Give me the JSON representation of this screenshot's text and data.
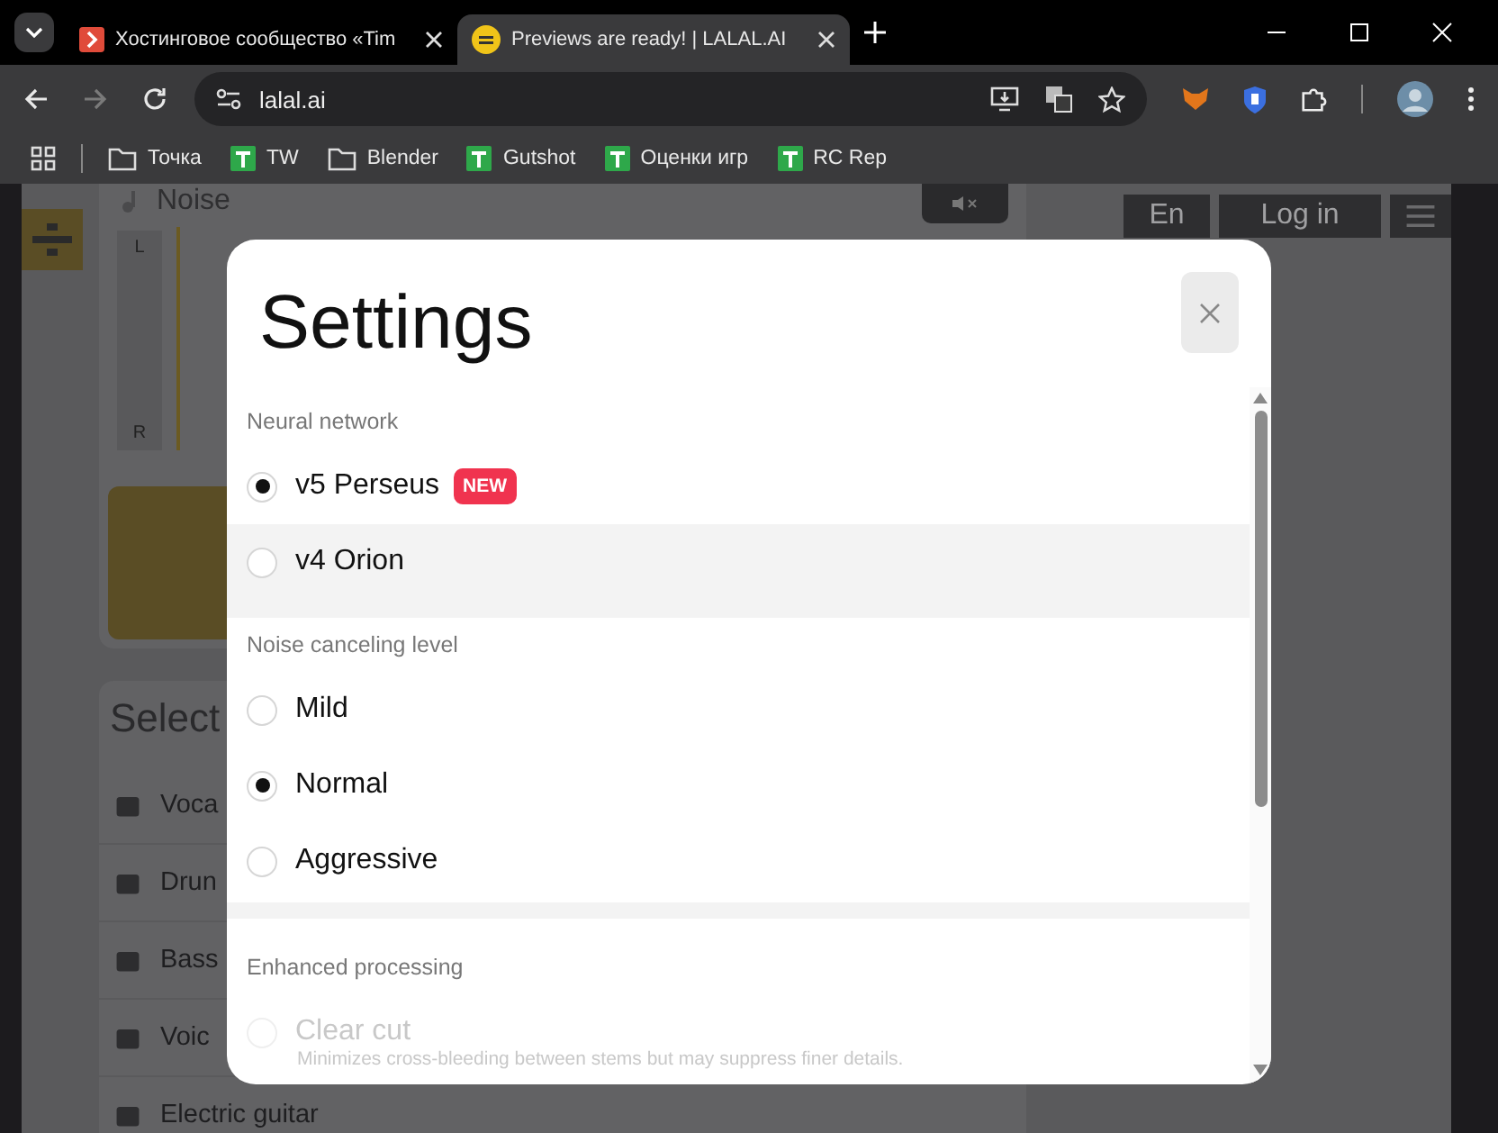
{
  "browser": {
    "tabs": [
      {
        "title": "Хостинговое сообщество «Tim",
        "selected": false
      },
      {
        "title": "Previews are ready! | LALAL.AI",
        "selected": true
      }
    ],
    "address": "lalal.ai",
    "bookmarks": [
      {
        "label": "Точка",
        "kind": "folder"
      },
      {
        "label": "TW",
        "kind": "site"
      },
      {
        "label": "Blender",
        "kind": "folder"
      },
      {
        "label": "Gutshot",
        "kind": "site"
      },
      {
        "label": "Оценки игр",
        "kind": "site"
      },
      {
        "label": "RC Rep",
        "kind": "site"
      }
    ]
  },
  "page": {
    "track": {
      "name": "Noise",
      "left": "L",
      "right": "R"
    },
    "select_title": "Select",
    "stems": [
      "Voca",
      "Drun",
      "Bass",
      "Voic",
      "Electric guitar"
    ],
    "language": "En",
    "login": "Log in"
  },
  "settings": {
    "title": "Settings",
    "sections": [
      {
        "label": "Neural network",
        "options": [
          {
            "label": "v5 Perseus",
            "badge": "NEW",
            "selected": true,
            "hovered": false,
            "disabled": false
          },
          {
            "label": "v4 Orion",
            "selected": false,
            "hovered": true,
            "disabled": false
          }
        ]
      },
      {
        "label": "Noise canceling level",
        "options": [
          {
            "label": "Mild",
            "selected": false,
            "hovered": false,
            "disabled": false
          },
          {
            "label": "Normal",
            "selected": true,
            "hovered": false,
            "disabled": false
          },
          {
            "label": "Aggressive",
            "selected": false,
            "hovered": false,
            "disabled": false
          }
        ]
      },
      {
        "label": "Enhanced processing",
        "options": [
          {
            "label": "Clear cut",
            "description": "Minimizes cross-bleeding between stems but may suppress finer details.",
            "selected": false,
            "hovered": false,
            "disabled": true
          }
        ]
      }
    ]
  }
}
